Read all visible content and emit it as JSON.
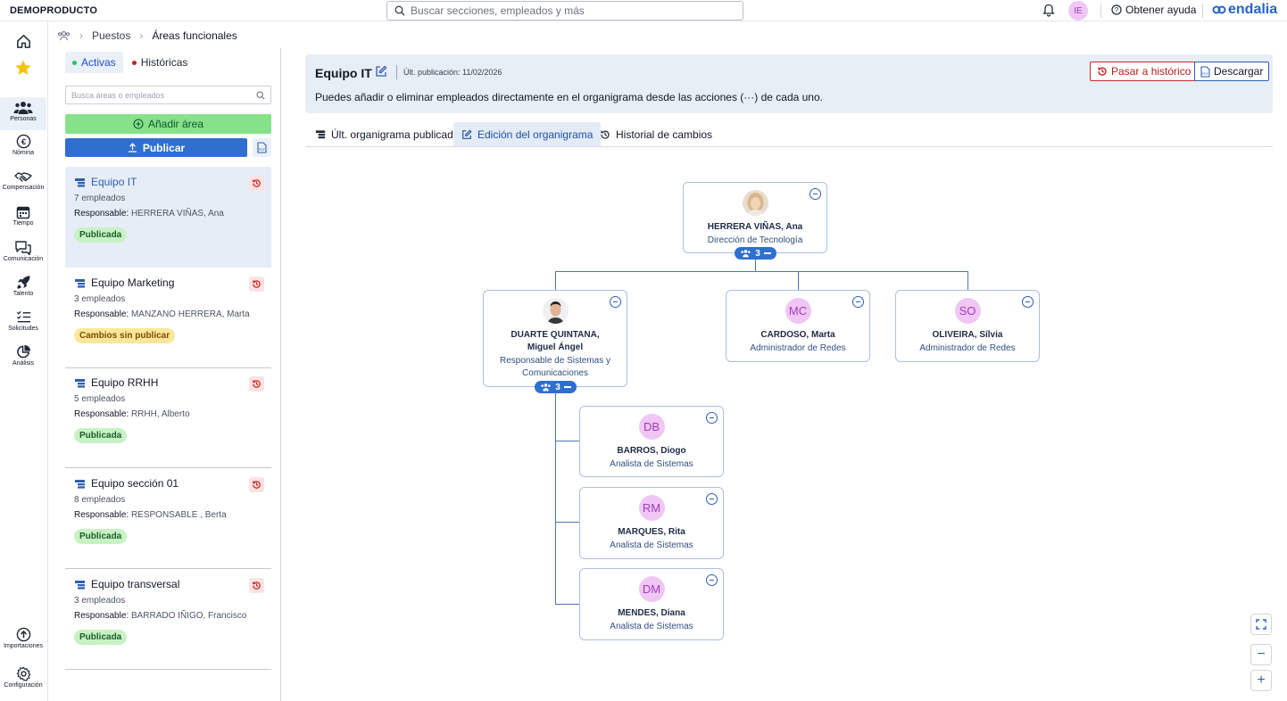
{
  "topbar": {
    "company": "DEMOPRODUCTO",
    "search_placeholder": "Buscar secciones, empleados y más",
    "user_initials": "IE",
    "help_label": "Obtener ayuda",
    "logo_text": "endalia"
  },
  "rail": [
    {
      "name": "home",
      "label": ""
    },
    {
      "name": "favorites",
      "label": ""
    },
    {
      "name": "personas",
      "label": "Personas"
    },
    {
      "name": "nomina",
      "label": "Nómina"
    },
    {
      "name": "compensacion",
      "label": "Compensación"
    },
    {
      "name": "tiempo",
      "label": "Tiempo"
    },
    {
      "name": "comunicacion",
      "label": "Comunicación"
    },
    {
      "name": "talento",
      "label": "Talento"
    },
    {
      "name": "solicitudes",
      "label": "Solicitudes"
    },
    {
      "name": "analisis",
      "label": "Análisis"
    },
    {
      "name": "importaciones",
      "label": "Importaciones"
    },
    {
      "name": "configuracion",
      "label": "Configuración"
    }
  ],
  "breadcrumb": {
    "item1": "Puestos",
    "item2": "Áreas funcionales"
  },
  "panel": {
    "tab_active": "Activas",
    "tab_history": "Históricas",
    "search_placeholder": "Busca áreas o empleados",
    "add_label": "Añadir área",
    "publish_label": "Publicar",
    "responsible_label": "Responsable:",
    "areas": [
      {
        "title": "Equipo IT",
        "count": "7 empleados",
        "responsible": "HERRERA VIÑAS, Ana",
        "status": "Publicada"
      },
      {
        "title": "Equipo Marketing",
        "count": "3 empleados",
        "responsible": "MANZANO HERRERA, Marta",
        "status": "Cambios sin publicar"
      },
      {
        "title": "Equipo RRHH",
        "count": "5 empleados",
        "responsible": "RRHH, Alberto",
        "status": "Publicada"
      },
      {
        "title": "Equipo sección 01",
        "count": "8 empleados",
        "responsible": "RESPONSABLE , Berta",
        "status": "Publicada"
      },
      {
        "title": "Equipo transversal",
        "count": "3 empleados",
        "responsible": "BARRADO IÑIGO, Francisco",
        "status": "Publicada"
      }
    ]
  },
  "main": {
    "title": "Equipo IT",
    "pub_date": "Últ. publicación: 11/02/2026",
    "description": "Puedes añadir o eliminar empleados directamente en el organigrama desde las acciones (···) de cada uno.",
    "btn_history": "Pasar a histórico",
    "btn_download": "Descargar",
    "tabs": [
      "Últ. organigrama publicado",
      "Edición del organigrama",
      "Historial de cambios"
    ]
  },
  "org": {
    "root": {
      "name": "HERRERA VIÑAS, Ana",
      "role": "Dirección de Tecnología",
      "reports": "3"
    },
    "level1": [
      {
        "name": "DUARTE QUINTANA, Miguel Ángel",
        "role": "Responsable de Sistemas y Comunicaciones",
        "reports": "3"
      },
      {
        "name": "CARDOSO, Marta",
        "role": "Administrador de Redes",
        "initials": "MC"
      },
      {
        "name": "OLIVEIRA, Sílvia",
        "role": "Administrador de Redes",
        "initials": "SO"
      }
    ],
    "level2": [
      {
        "name": "BARROS, Diogo",
        "role": "Analista de Sistemas",
        "initials": "DB"
      },
      {
        "name": "MARQUES, Rita",
        "role": "Analista de Sistemas",
        "initials": "RM"
      },
      {
        "name": "MENDES, Diana",
        "role": "Analista de Sistemas",
        "initials": "DM"
      }
    ]
  },
  "zoom": {
    "zoom_out": "−",
    "zoom_in": "+"
  },
  "colors": {
    "accent": "#2f6fd0",
    "avatar_bg": "#f0c6f5",
    "success": "#86e28a",
    "danger": "#c92a2a"
  }
}
